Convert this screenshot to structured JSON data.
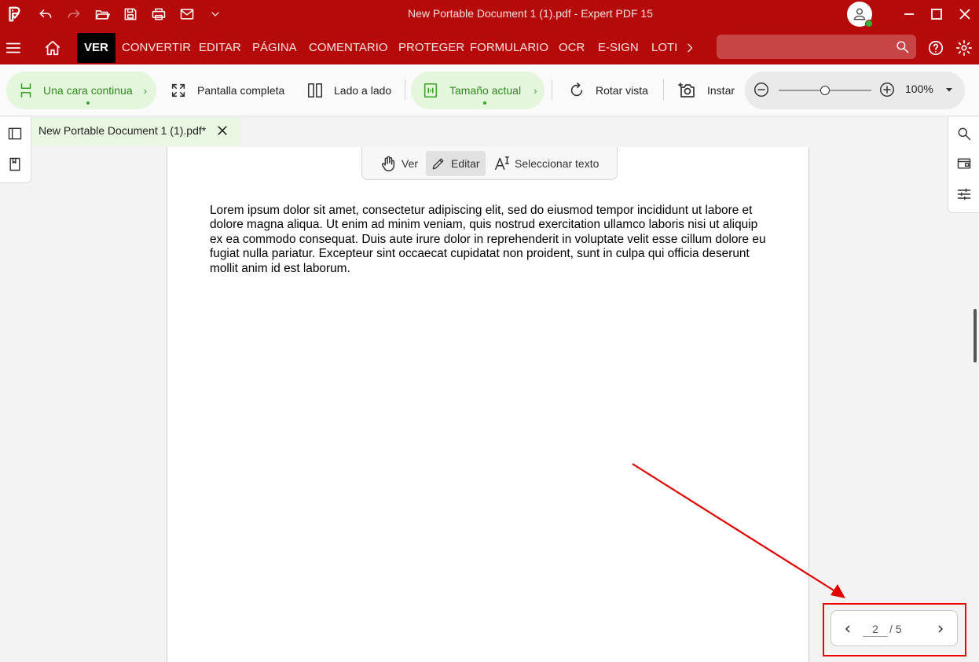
{
  "window": {
    "title": "New Portable Document 1 (1).pdf   -   Expert PDF 15"
  },
  "quick_access": [
    "app-logo-icon",
    "undo-icon",
    "redo-icon",
    "open-folder-icon",
    "save-icon",
    "print-icon",
    "mail-icon",
    "chevron-down-icon"
  ],
  "menu": {
    "items": [
      "VER",
      "CONVERTIR",
      "EDITAR",
      "PÁGINA",
      "COMENTARIO",
      "PROTEGER",
      "FORMULARIO",
      "OCR",
      "E-SIGN",
      "LOTI"
    ],
    "active": "VER",
    "search_placeholder": ""
  },
  "toolbar": {
    "one_page_continuous": "Una cara continua",
    "full_screen": "Pantalla completa",
    "side_by_side": "Lado a lado",
    "actual_size": "Tamaño actual",
    "rotate_view": "Rotar vista",
    "snapshot": "Instar",
    "zoom_value": "100%",
    "zoom_level": 0.5
  },
  "document": {
    "tab_title": "New Portable Document 1 (1).pdf*",
    "modes": {
      "view": "Ver",
      "edit": "Editar",
      "select_text": "Seleccionar texto"
    },
    "selected_mode": "Editar",
    "body": "Lorem ipsum dolor sit amet, consectetur adipiscing elit, sed do eiusmod tempor incididunt ut labore et dolore magna aliqua. Ut enim ad minim veniam, quis nostrud exercitation ullamco laboris nisi ut aliquip ex ea commodo consequat. Duis aute irure dolor in reprehenderit in voluptate velit esse cillum dolore eu fugiat nulla pariatur. Excepteur sint occaecat cupidatat non proident, sunt in culpa qui officia deserunt mollit anim id est laborum."
  },
  "page_nav": {
    "current": "2",
    "total_label": "/ 5"
  },
  "colors": {
    "brand_red": "#b60a0a",
    "accent_green": "#37a12a",
    "annotation_red": "#e00000"
  }
}
